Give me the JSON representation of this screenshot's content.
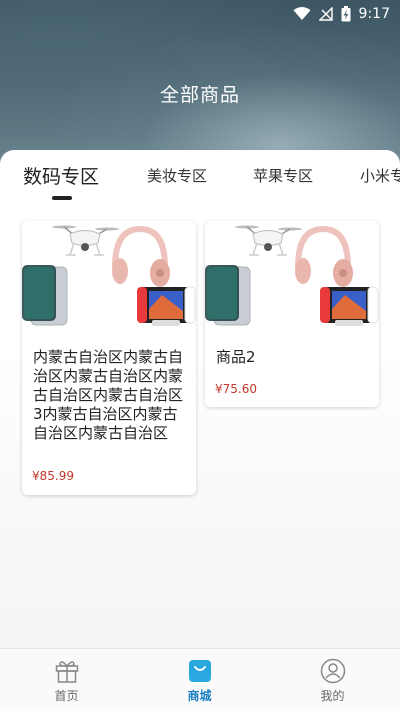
{
  "status_bar": {
    "time": "9:17"
  },
  "header": {
    "title": "全部商品"
  },
  "tabs": [
    {
      "label": "数码专区",
      "active": true
    },
    {
      "label": "美妆专区",
      "active": false
    },
    {
      "label": "苹果专区",
      "active": false
    },
    {
      "label": "小米专",
      "active": false
    }
  ],
  "products": [
    {
      "name": "内蒙古自治区内蒙古自治区内蒙古自治区内蒙古自治区内蒙古自治区3内蒙古自治区内蒙古自治区内蒙古自治区",
      "price": "¥85.99"
    },
    {
      "name": "商品2",
      "price": "¥75.60"
    }
  ],
  "bottom_nav": [
    {
      "label": "首页",
      "icon": "gift-icon",
      "active": false
    },
    {
      "label": "商城",
      "icon": "shopping-bag-icon",
      "active": true
    },
    {
      "label": "我的",
      "icon": "user-icon",
      "active": false
    }
  ],
  "colors": {
    "accent": "#1a7fc1",
    "price": "#c0392b"
  }
}
